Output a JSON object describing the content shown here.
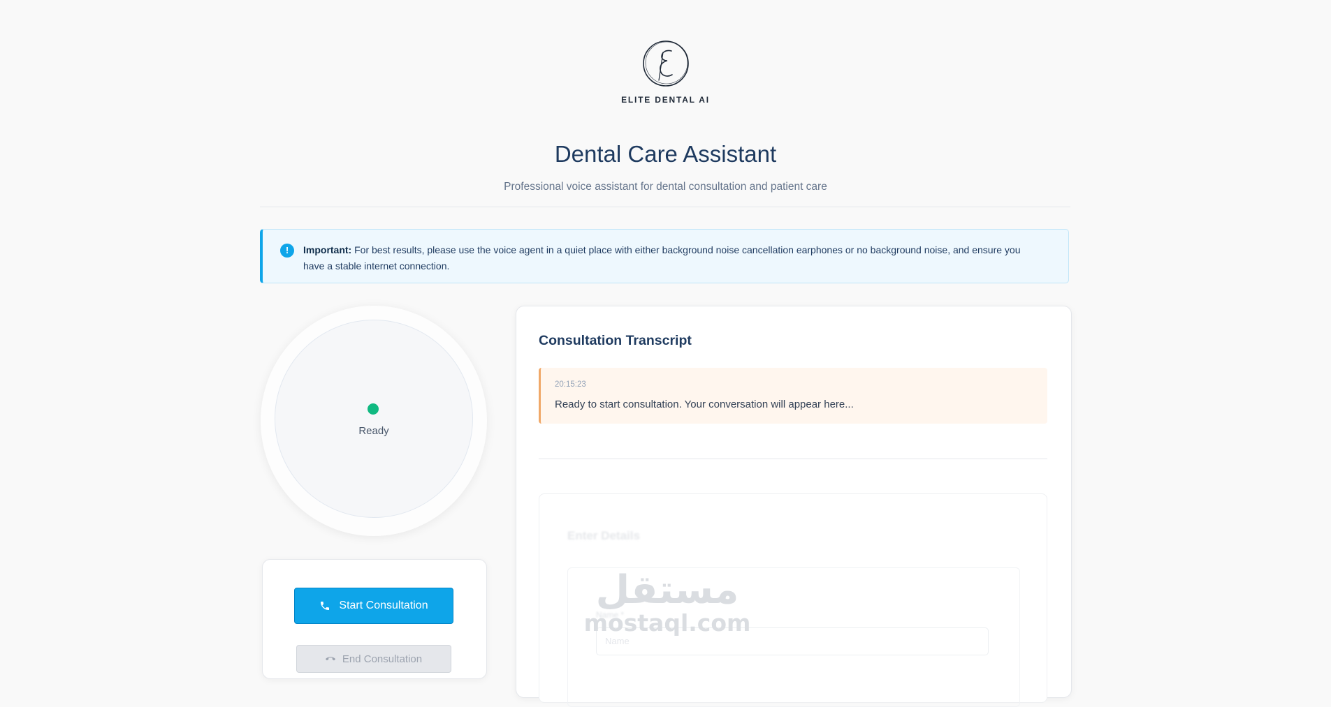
{
  "brand": {
    "name": "ELITE DENTAL AI",
    "logo_letter": "E"
  },
  "header": {
    "title": "Dental Care Assistant",
    "subtitle": "Professional voice assistant for dental consultation and patient care"
  },
  "notice": {
    "icon": "info-icon",
    "label": "Important:",
    "text": "For best results, please use the voice agent in a quiet place with either background noise cancellation earphones or no background noise, and ensure you have a stable internet connection."
  },
  "status": {
    "label": "Ready",
    "color": "#10b981"
  },
  "controls": {
    "start_label": "Start Consultation",
    "start_icon": "phone-icon",
    "end_label": "End Consultation",
    "end_icon": "phone-end-icon"
  },
  "transcript": {
    "title": "Consultation Transcript",
    "messages": [
      {
        "time": "20:15:23",
        "text": "Ready to start consultation. Your conversation will appear here..."
      }
    ]
  },
  "details_form": {
    "title": "Enter Details",
    "field_label": "Name *",
    "field_placeholder": "Name"
  },
  "watermark": {
    "arabic": "مستقل",
    "latin": "mostaql.com"
  },
  "colors": {
    "accent": "#0ea5e9",
    "ready": "#10b981",
    "notice_bg": "#eef8fe",
    "message_accent": "#f0a868"
  }
}
